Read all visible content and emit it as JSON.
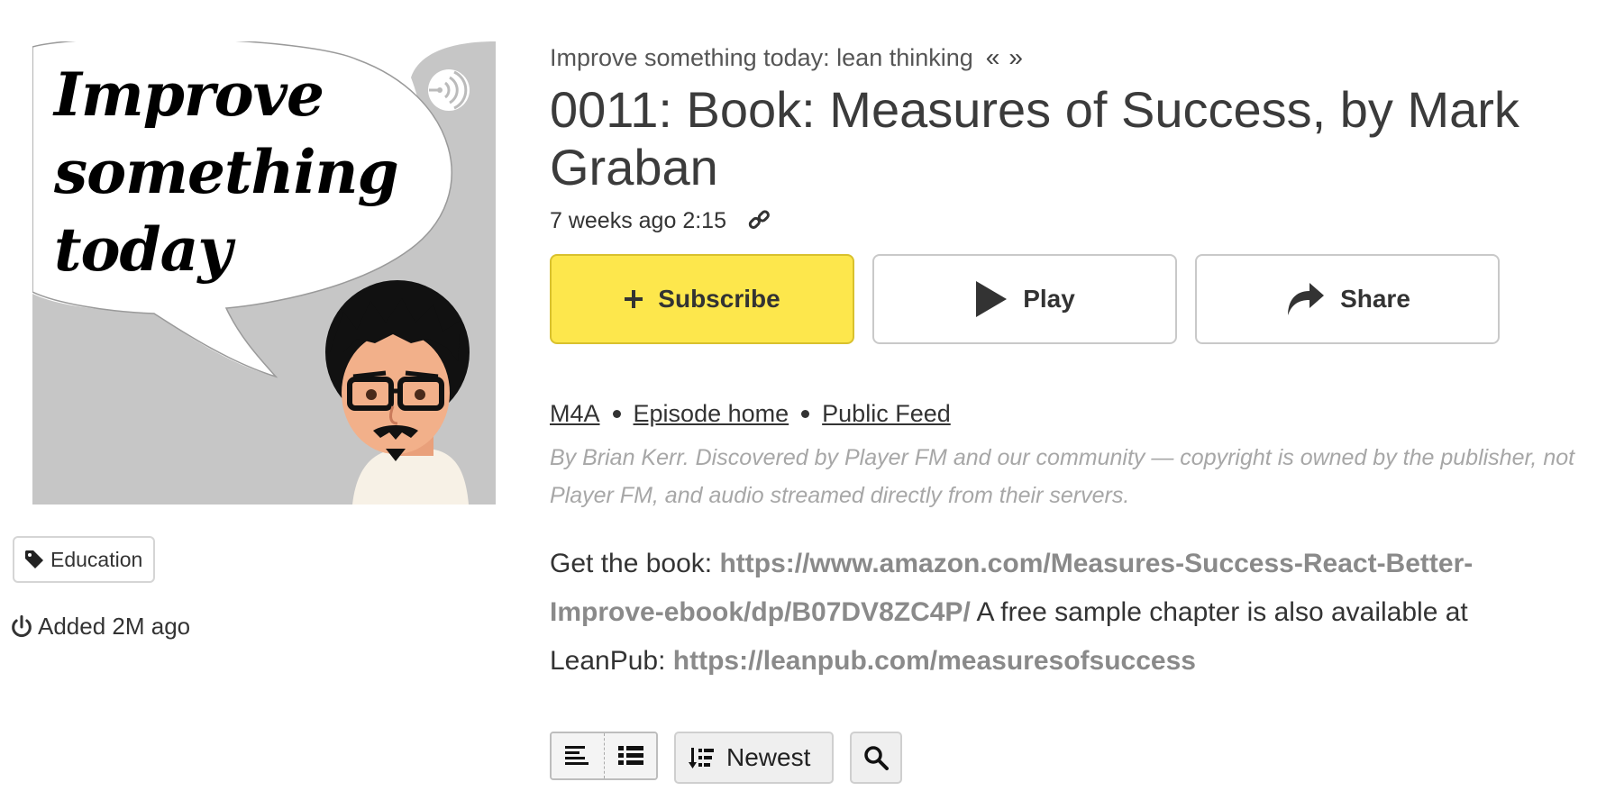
{
  "artwork": {
    "title_text": "Improve\nsomething\ntoday"
  },
  "left": {
    "category": "Education",
    "added": "Added 2M ago"
  },
  "header": {
    "series_title": "Improve something today: lean thinking",
    "prev_glyph": "«",
    "next_glyph": "»",
    "episode_title": "0011: Book: Measures of Success, by Mark Graban",
    "age": "7 weeks ago",
    "duration": "2:15"
  },
  "actions": {
    "subscribe_label": "Subscribe",
    "play_label": "Play",
    "share_label": "Share"
  },
  "links": {
    "format": "M4A",
    "episode_home": "Episode home",
    "public_feed": "Public Feed"
  },
  "disclaimer": "By Brian Kerr. Discovered by Player FM and our community — copyright is owned by the publisher, not Player FM, and audio streamed directly from their servers.",
  "description": {
    "intro": "Get the book: ",
    "book_url": "https://www.amazon.com/Measures-Success-React-Better-Improve-ebook/dp/B07DV8ZC4P/",
    "middle": " A free sample chapter is also available at LeanPub: ",
    "leanpub_url": "https://leanpub.com/measuresofsuccess"
  },
  "toolbar": {
    "sort_label": "Newest"
  },
  "colors": {
    "subscribe_bg": "#fde74c",
    "artwork_bg": "#c6c6c6",
    "link_bold": "#8a8a8a",
    "disclaimer": "#a7a7a7"
  },
  "icons": [
    "podcast-icon",
    "tag-icon",
    "power-icon",
    "link-icon",
    "plus-icon",
    "play-icon",
    "share-icon",
    "compact-view-icon",
    "list-view-icon",
    "sort-icon",
    "search-icon"
  ]
}
